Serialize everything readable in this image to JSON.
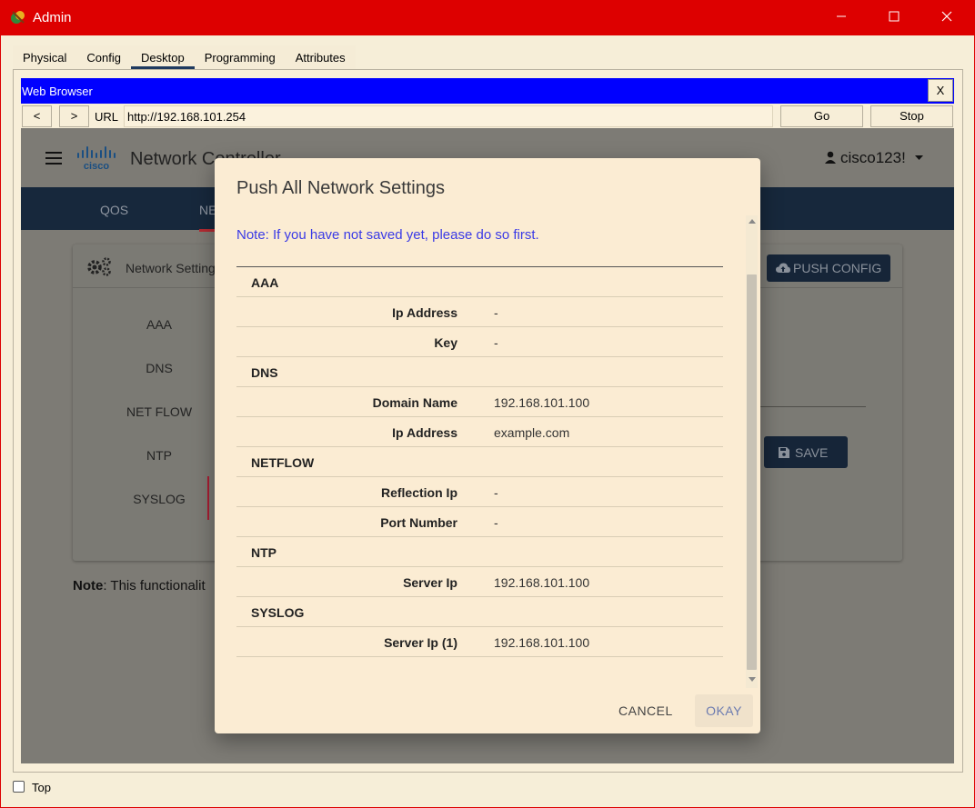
{
  "window": {
    "title": "Admin"
  },
  "tabs": [
    "Physical",
    "Config",
    "Desktop",
    "Programming",
    "Attributes"
  ],
  "browser": {
    "title": "Web Browser",
    "close_label": "X",
    "back_label": "<",
    "forward_label": ">",
    "url_label": "URL",
    "url": "http://192.168.101.254",
    "go_label": "Go",
    "stop_label": "Stop"
  },
  "app": {
    "title": "Network Controller",
    "user": "cisco123!",
    "nav": [
      "QOS",
      "NE"
    ],
    "card_title": "Network Setting",
    "push_config_label": "PUSH CONFIG",
    "side_items": [
      "AAA",
      "DNS",
      "NET FLOW",
      "NTP",
      "SYSLOG"
    ],
    "save_label": "SAVE",
    "note_bold": "Note",
    "note_text": ": This functionalit"
  },
  "modal": {
    "title": "Push All Network Settings",
    "note": "Note: If you have not saved yet, please do so first.",
    "rows": [
      {
        "section": "AAA"
      },
      {
        "label": "Ip Address",
        "value": "-"
      },
      {
        "label": "Key",
        "value": "-"
      },
      {
        "section": "DNS"
      },
      {
        "label": "Domain Name",
        "value": "192.168.101.100"
      },
      {
        "label": "Ip Address",
        "value": "example.com"
      },
      {
        "section": "NETFLOW"
      },
      {
        "label": "Reflection Ip",
        "value": "-"
      },
      {
        "label": "Port Number",
        "value": "-"
      },
      {
        "section": "NTP"
      },
      {
        "label": "Server Ip",
        "value": "192.168.101.100"
      },
      {
        "section": "SYSLOG"
      },
      {
        "label": "Server Ip (1)",
        "value": "192.168.101.100"
      }
    ],
    "cancel_label": "CANCEL",
    "okay_label": "OKAY"
  },
  "footer": {
    "top_label": "Top"
  }
}
